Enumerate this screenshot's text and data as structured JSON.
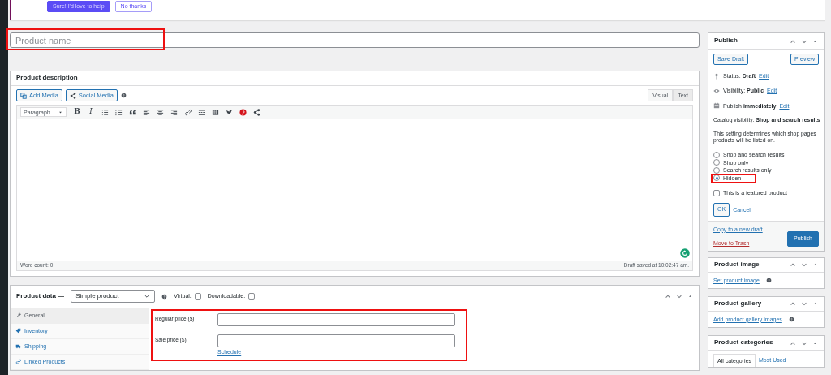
{
  "notice": {
    "buttons": [
      {
        "label": "Sure! I'd love to help",
        "kind": "primary"
      },
      {
        "label": "No thanks",
        "kind": "outline"
      }
    ]
  },
  "title_field": {
    "placeholder": "Product name",
    "highlighted": true
  },
  "description": {
    "title": "Product description",
    "media_buttons": [
      {
        "label": "Add Media",
        "kind": "media"
      },
      {
        "label": "Social Media",
        "kind": "share"
      }
    ],
    "editor_tabs": [
      {
        "label": "Visual",
        "selected": true
      },
      {
        "label": "Text",
        "selected": false
      }
    ],
    "format_select": "Paragraph",
    "toolbar": [
      {
        "kind": "bold",
        "label": "B"
      },
      {
        "kind": "italic",
        "label": "I"
      },
      {
        "kind": "bullets"
      },
      {
        "kind": "numbers"
      },
      {
        "kind": "quote"
      },
      {
        "kind": "align-left"
      },
      {
        "kind": "align-center"
      },
      {
        "kind": "align-right"
      },
      {
        "kind": "link"
      },
      {
        "kind": "more"
      },
      {
        "kind": "toolbar-toggle"
      },
      {
        "kind": "bird"
      },
      {
        "kind": "pin"
      },
      {
        "kind": "share"
      }
    ],
    "word_count": "Word count: 0",
    "draft_saved": "Draft saved at 10:02:47 am."
  },
  "product_data": {
    "title": "Product data —",
    "type_select": "Simple product",
    "options": [
      {
        "label": "Virtual:",
        "checked": false
      },
      {
        "label": "Downloadable:",
        "checked": false
      }
    ],
    "tabs": [
      {
        "label": "General",
        "kind": "wrench",
        "selected": true
      },
      {
        "label": "Inventory",
        "kind": "tag",
        "selected": false
      },
      {
        "label": "Shipping",
        "kind": "truck",
        "selected": false
      },
      {
        "label": "Linked Products",
        "kind": "link",
        "selected": false
      }
    ],
    "fields": [
      {
        "label": "Regular price ($)"
      },
      {
        "label": "Sale price ($)",
        "link": "Schedule"
      }
    ],
    "highlighted": true
  },
  "publish": {
    "title": "Publish",
    "save_draft": "Save Draft",
    "preview": "Preview",
    "meta": [
      {
        "kind": "pin",
        "label": "Status:",
        "value": "Draft",
        "link": "Edit"
      },
      {
        "kind": "eye",
        "label": "Visibility:",
        "value": "Public",
        "link": "Edit"
      },
      {
        "kind": "calendar",
        "label": "Publish",
        "value": "immediately",
        "link": "Edit"
      }
    ],
    "catalog_label": "Catalog visibility:",
    "catalog_value": "Shop and search results",
    "note": "This setting determines which shop pages products will be listed on.",
    "visibility_options": [
      {
        "label": "Shop and search results",
        "selected": false,
        "highlighted": false
      },
      {
        "label": "Shop only",
        "selected": false,
        "highlighted": false
      },
      {
        "label": "Search results only",
        "selected": false,
        "highlighted": false
      },
      {
        "label": "Hidden",
        "selected": true,
        "highlighted": true
      }
    ],
    "featured": {
      "label": "This is a featured product",
      "checked": false
    },
    "ok": "OK",
    "cancel": "Cancel",
    "copy_link": "Copy to a new draft",
    "trash_link": "Move to Trash",
    "publish_button": "Publish"
  },
  "side_boxes": [
    {
      "title": "Product image",
      "kind": "link",
      "link": "Set product image"
    },
    {
      "title": "Product gallery",
      "kind": "link",
      "link": "Add product gallery images"
    },
    {
      "title": "Product categories",
      "kind": "tabs",
      "tabs": [
        {
          "label": "All categories",
          "selected": true
        },
        {
          "label": "Most Used",
          "selected": false
        }
      ]
    }
  ]
}
